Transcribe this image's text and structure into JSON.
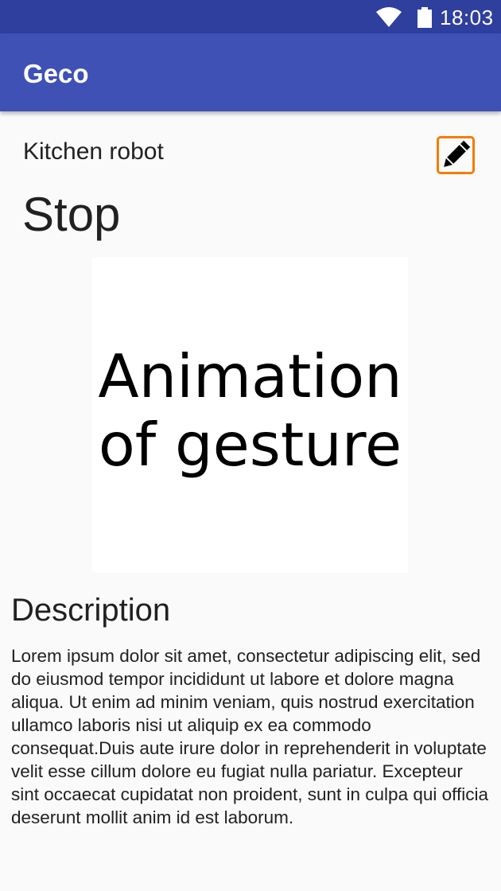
{
  "status_bar": {
    "time": "18:03",
    "icons": [
      "wifi-icon",
      "battery-icon"
    ]
  },
  "app_bar": {
    "title": "Geco",
    "color": "#3f51b5",
    "status_color": "#2f3f9e"
  },
  "detail": {
    "robot_name": "Kitchen robot",
    "edit_icon": "pencil-icon",
    "edit_border_color": "#f57c00",
    "gesture_name": "Stop",
    "animation_placeholder": "Animation of gesture",
    "description_heading": "Description",
    "description_text": "Lorem ipsum dolor sit amet, consectetur adipiscing elit, sed do eiusmod tempor incididunt ut labore et dolore magna aliqua. Ut enim ad minim veniam, quis nostrud exercitation ullamco laboris nisi ut aliquip ex ea commodo consequat.Duis aute irure dolor in reprehenderit in voluptate velit esse cillum dolore eu fugiat nulla pariatur. Excepteur sint occaecat cupidatat non proident, sunt in culpa qui officia deserunt mollit anim id est laborum."
  }
}
